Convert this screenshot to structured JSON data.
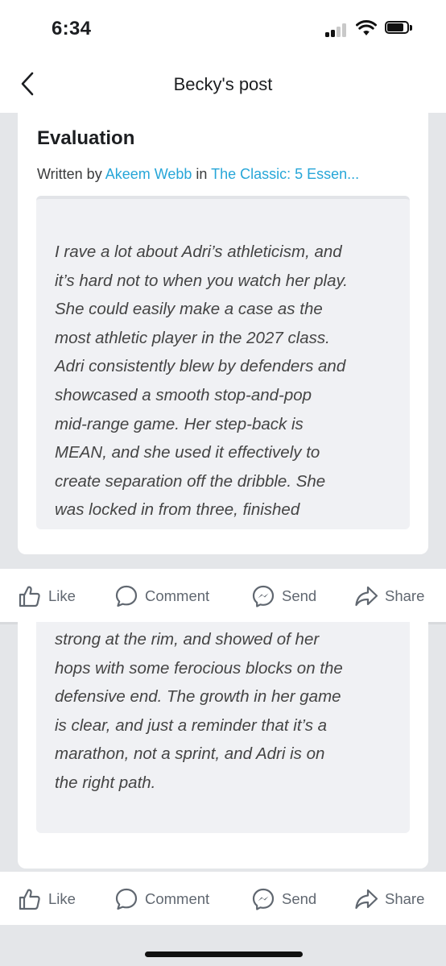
{
  "status_bar": {
    "time": "6:34"
  },
  "header": {
    "title": "Becky's post"
  },
  "article": {
    "title": "Evaluation",
    "byline_prefix": "Written by ",
    "author": "Akeem Webb",
    "byline_middle": " in ",
    "publication": "The Classic: 5 Essen...",
    "quote_lines_top": [
      "I rave a lot about Adri’s athleticism, and",
      "it’s hard not to when you watch her play.",
      "She could easily make a case as the",
      "most athletic player in the 2027 class.",
      "Adri consistently blew by defenders and",
      "showcased a smooth stop-and-pop",
      "mid-range game. Her step-back is",
      "MEAN, and she used it effectively to",
      "create separation off the dribble. She",
      "was locked in from three, finished"
    ],
    "quote_lines_bottom": [
      "strong at the rim, and showed of her",
      "hops with some ferocious blocks on the",
      "defensive end. The growth in her game",
      "is clear, and just a reminder that it’s a",
      "marathon, not a sprint, and Adri is on",
      "the right path."
    ]
  },
  "actions": {
    "like": "Like",
    "comment": "Comment",
    "send": "Send",
    "share": "Share"
  }
}
